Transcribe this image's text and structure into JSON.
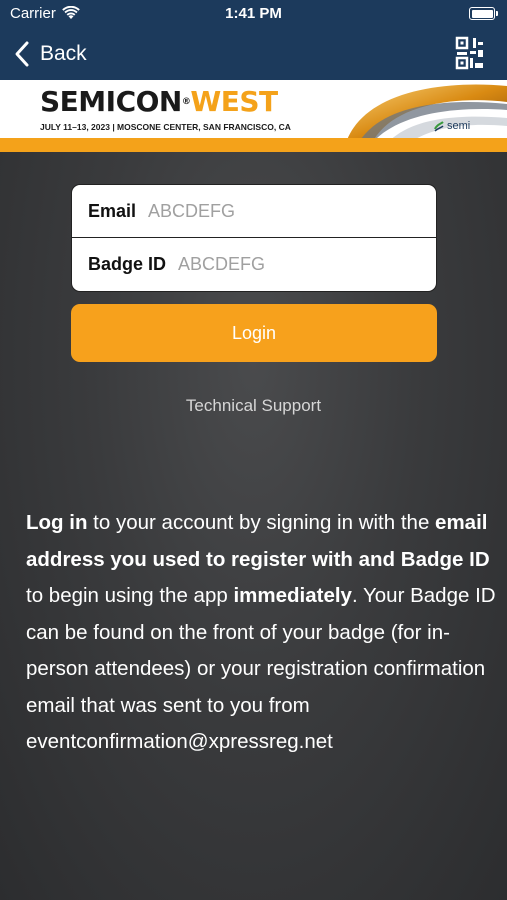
{
  "status_bar": {
    "carrier": "Carrier",
    "time": "1:41 PM",
    "wifi_icon": "wifi-icon",
    "battery_icon": "battery-icon",
    "battery_level": 1.0
  },
  "nav": {
    "back_label": "Back",
    "back_icon": "chevron-left-icon",
    "qr_icon": "qr-code-icon"
  },
  "banner": {
    "title_part1": "SEMICON",
    "registered_mark": "®",
    "title_part2": "WEST",
    "subtitle": "JULY 11–13, 2023 | MOSCONE CENTER, SAN FRANCISCO, CA",
    "partner_logo": "semi",
    "colors": {
      "accent": "#f4a21a",
      "dark": "#1a1a1a"
    }
  },
  "form": {
    "email_label": "Email",
    "email_placeholder": "ABCDEFG",
    "badge_label": "Badge ID",
    "badge_placeholder": "ABCDEFG",
    "login_label": "Login"
  },
  "support_link": "Technical Support",
  "instructions": {
    "p1_bold": "Log in",
    "p2": " to your account by signing in with the ",
    "p3_bold": "email address you used to register with and Badge ID",
    "p4": " to begin using the app ",
    "p5_bold": "immediately",
    "p6": ". Your Badge ID can be found on the front of your badge (for in-person attendees) or your registration confirmation email that was sent to you from eventconfirmation@xpressreg.net"
  },
  "colors": {
    "nav_background": "#1c3a5c",
    "login_button": "#f7a11c",
    "page_background": "#3a3b3d"
  }
}
